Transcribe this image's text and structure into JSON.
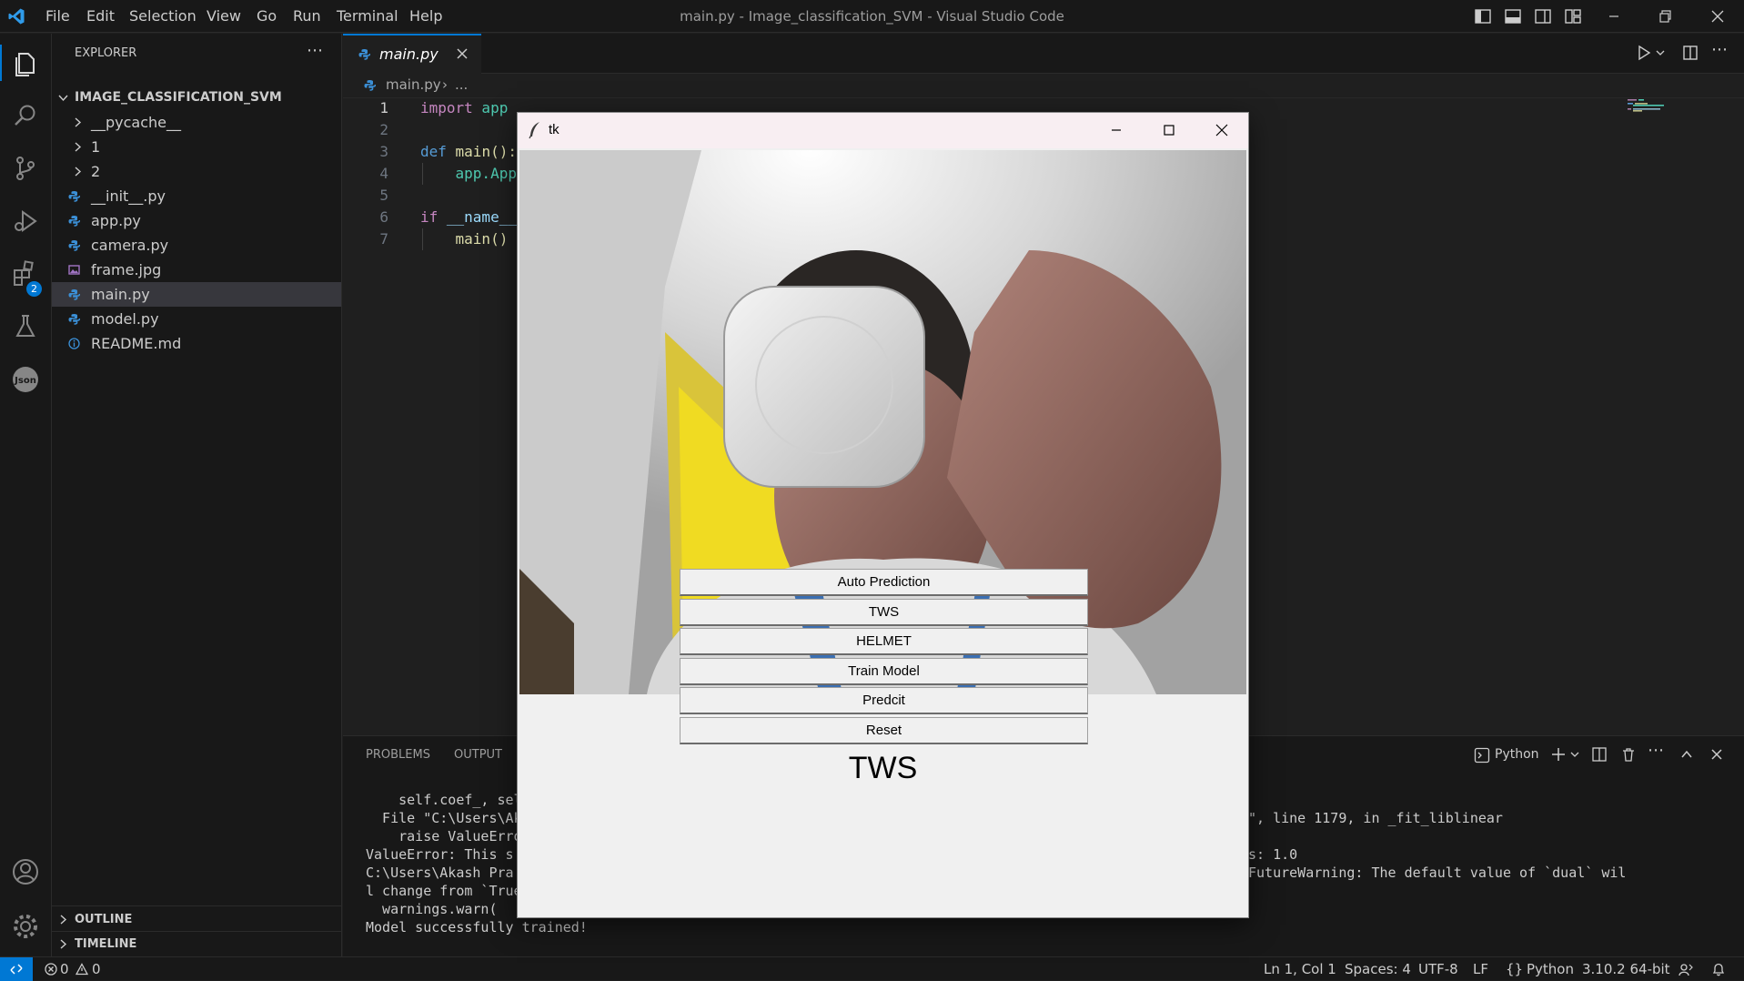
{
  "window_title": "main.py - Image_classification_SVM - Visual Studio Code",
  "menu": [
    "File",
    "Edit",
    "Selection",
    "View",
    "Go",
    "Run",
    "Terminal",
    "Help"
  ],
  "explorer": {
    "header": "EXPLORER",
    "folder": "IMAGE_CLASSIFICATION_SVM",
    "items": [
      {
        "label": "__pycache__",
        "kind": "folder"
      },
      {
        "label": "1",
        "kind": "folder"
      },
      {
        "label": "2",
        "kind": "folder"
      },
      {
        "label": "__init__.py",
        "kind": "python"
      },
      {
        "label": "app.py",
        "kind": "python"
      },
      {
        "label": "camera.py",
        "kind": "python"
      },
      {
        "label": "frame.jpg",
        "kind": "image"
      },
      {
        "label": "main.py",
        "kind": "python",
        "selected": true
      },
      {
        "label": "model.py",
        "kind": "python"
      },
      {
        "label": "README.md",
        "kind": "info"
      }
    ],
    "outline": "OUTLINE",
    "timeline": "TIMELINE"
  },
  "extensions_badge": "2",
  "editor": {
    "tab": "main.py",
    "breadcrumb_file": "main.py",
    "breadcrumb_rest": "...",
    "line_numbers": [
      "1",
      "2",
      "3",
      "4",
      "5",
      "6",
      "7"
    ],
    "lines": [
      {
        "kw": "import",
        "rest": " app"
      },
      {
        "kw": "",
        "rest": ""
      },
      {
        "kw": "def",
        "rest": " main():"
      },
      {
        "kw": "",
        "rest": "    app.App"
      },
      {
        "kw": "",
        "rest": ""
      },
      {
        "kw": "if",
        "rest": " __name__"
      },
      {
        "kw": "",
        "rest": "    main()"
      }
    ]
  },
  "panel": {
    "tabs": [
      "PROBLEMS",
      "OUTPUT"
    ],
    "terminal_name": "Python",
    "left_lines": [
      "    self.coef_, sel",
      "  File \"C:\\Users\\Ak",
      "    raise ValueErro",
      "ValueError: This s",
      "C:\\Users\\Akash Pra",
      "l change from `True",
      "  warnings.warn(",
      "Model successfully trained!"
    ],
    "right_lines": [
      "\", line 1179, in _fit_liblinear",
      "s: 1.0",
      "FutureWarning: The default value of `dual` wil"
    ]
  },
  "status": {
    "errors": "0",
    "warnings": "0",
    "position": "Ln 1, Col 1",
    "spaces": "Spaces: 4",
    "encoding": "UTF-8",
    "eol": "LF",
    "language": "Python",
    "interpreter": "3.10.2 64-bit"
  },
  "tk": {
    "title": "tk",
    "buttons": [
      "Auto Prediction",
      "TWS",
      "HELMET",
      "Train Model",
      "Predcit",
      "Reset"
    ],
    "result": "TWS"
  },
  "colors": {
    "accent": "#0078d4",
    "keyword": "#c586c0",
    "def": "#569cd6"
  }
}
